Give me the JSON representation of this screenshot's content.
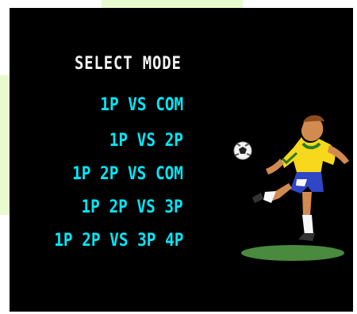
{
  "menu": {
    "title": "SELECT MODE",
    "options": [
      "1P VS COM",
      "1P VS 2P",
      "1P 2P VS COM",
      "1P 2P VS 3P",
      "1P 2P VS 3P 4P"
    ]
  },
  "colors": {
    "background": "#000000",
    "title_text": "#f2f2f2",
    "option_text": "#00e8f8",
    "pitch_shadow": "#4a8a3e",
    "jersey": "#f8d81c",
    "shorts": "#2f46c7",
    "outer_glow": "#e7fbcf"
  },
  "icons": {
    "ball": "soccer-ball-icon",
    "player": "soccer-player-illustration"
  }
}
